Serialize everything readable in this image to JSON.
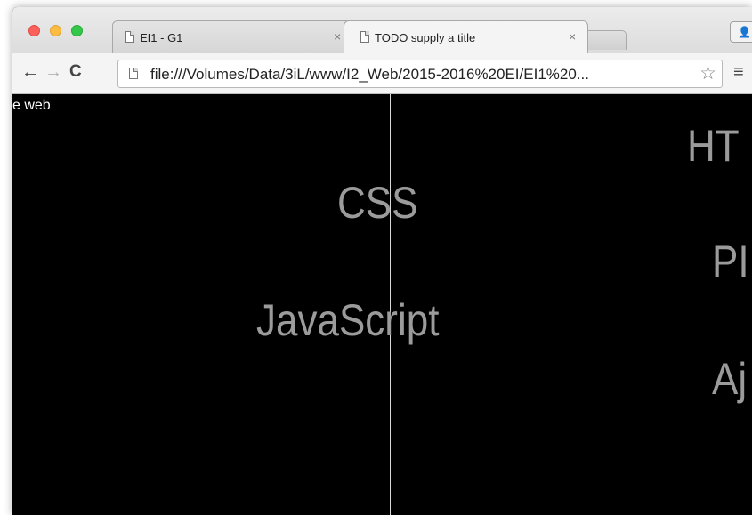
{
  "browser": {
    "tabs": [
      {
        "title": "EI1 - G1",
        "close": "×",
        "active": false
      },
      {
        "title": "TODO supply a title",
        "close": "×",
        "active": true
      }
    ],
    "address": {
      "url": "file:///Volumes/Data/3iL/www/I2_Web/2015-2016%20EI/EI1%20..."
    },
    "icons": {
      "back": "←",
      "forward": "→",
      "reload": "C",
      "star": "☆",
      "menu": "≡",
      "user": "👤"
    }
  },
  "page": {
    "corner_text": "e web",
    "words": [
      "CSS",
      "JavaScript",
      "HT",
      "PI",
      "Aj"
    ],
    "text_color": "#9b9b9b",
    "background": "#000000"
  }
}
